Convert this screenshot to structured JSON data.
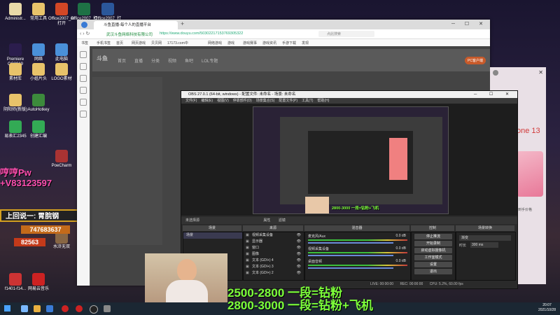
{
  "desktop": {
    "icons": [
      {
        "label": "Administr...",
        "color": "#e8d9a8"
      },
      {
        "label": "常用工具",
        "color": "#e8c36a"
      },
      {
        "label": "Office2007_AI打开",
        "color": "#d24726"
      },
      {
        "label": "Office2007_打开",
        "color": "#1e7145"
      },
      {
        "label": "Office2007_打开W",
        "color": "#2b579a"
      },
      {
        "label": "Premiere CC2019",
        "color": "#2b1d4d"
      },
      {
        "label": "网络",
        "color": "#4a90d9"
      },
      {
        "label": "此电脑",
        "color": "#4a90d9"
      },
      {
        "label": "素材库",
        "color": "#e8c36a"
      },
      {
        "label": "小姐片头",
        "color": "#e8c36a"
      },
      {
        "label": "LOGO素材",
        "color": "#e8c36a"
      },
      {
        "label": "阴阳师(新版)",
        "color": "#e8c36a"
      },
      {
        "label": "AutoHotkey",
        "color": "#3c8a3c"
      },
      {
        "label": "易表汇2345",
        "color": "#33aa55"
      },
      {
        "label": "创建汇编",
        "color": "#33aa55"
      },
      {
        "label": "PoeCharm",
        "color": "#aa3333"
      },
      {
        "label": "水浒无双",
        "color": "#886644"
      },
      {
        "label": "f1401-f14...",
        "color": "#cc3333"
      },
      {
        "label": "网易云音乐",
        "color": "#cc2222"
      }
    ]
  },
  "overlay": {
    "pink_text": "哼哼Pw",
    "phone": "+V83123597",
    "banner": "上回说一: 胃脘钢",
    "code1": "747683637",
    "code2": "82563",
    "line1": "2500-2800 一段=钻粉",
    "line2": "2800-3000 一段=钻粉+飞机"
  },
  "browser": {
    "tab_title": "斗鱼直播-每个人的直播平台",
    "url_site": "武汉斗鱼网络科技有限公司",
    "url": "https://www.douyu.com/50302217153769305322",
    "search_placeholder": "点此搜索",
    "bookmarks": [
      "书签",
      "手机书签",
      "首页",
      "网页游戏",
      "贝贝网",
      "17173.com中",
      "网络游戏",
      "游戏",
      "游戏赛事",
      "游戏资讯",
      "手游下载",
      "发现"
    ],
    "nav_items": [
      "首页",
      "直播",
      "分类",
      "视频",
      "鱼吧",
      "LOL专题"
    ],
    "download_btn": "PC客户端"
  },
  "obs": {
    "title": "OBS 27.0.1 (64-bit, windows) - 配置文件: 未命名 - 场景: 未命名",
    "menu": [
      "文件(F)",
      "编辑(E)",
      "视图(V)",
      "停靠部件(D)",
      "场景集合(S)",
      "配置文件(P)",
      "工具(T)",
      "帮助(H)"
    ],
    "status_label": "未选择源",
    "tabs": [
      "属性",
      "滤镜"
    ],
    "docks": {
      "scenes": "场景",
      "sources": "来源",
      "mixer": "混音器",
      "transitions": "场景转换",
      "controls": "控制"
    },
    "scenes": [
      "场景"
    ],
    "sources": [
      "视频采集设备",
      "显示器",
      "窗口",
      "图像",
      "文本 (GDI+) 4",
      "文本 (GDI+) 3",
      "文本 (GDI+) 2"
    ],
    "mixer": [
      {
        "name": "麦克风/Aux",
        "db": "0.0 dB"
      },
      {
        "name": "视频采集设备",
        "db": "0.0 dB"
      },
      {
        "name": "桌面音频",
        "db": "0.0 dB"
      }
    ],
    "transition": {
      "type": "渐变",
      "duration_label": "时长",
      "duration": "300 ms"
    },
    "controls": [
      "停止推流",
      "开始录制",
      "启动虚拟摄像机",
      "工作室模式",
      "设置",
      "退出"
    ],
    "statusbar": {
      "live": "LIVE: 00:00:00",
      "rec": "REC: 00:00:00",
      "cpu": "CPU: 5.2%, 60.00 fps"
    }
  },
  "right_ad": {
    "text": "one 13",
    "caption": "到手价格"
  },
  "clock": {
    "time": "20:07",
    "date": "2021/10/28"
  }
}
